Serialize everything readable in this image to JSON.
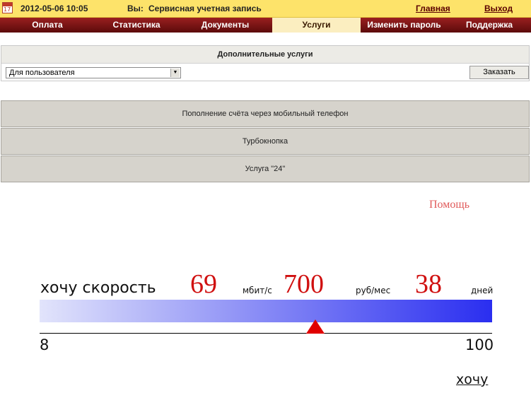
{
  "topbar": {
    "calendar_icon": "calendar-icon",
    "calendar_day": "17",
    "datetime": "2012-05-06 10:05",
    "you_label": "Вы:",
    "account": "Сервисная учетная запись",
    "home_link": "Главная",
    "logout_link": "Выход"
  },
  "nav": {
    "items": [
      "Оплата",
      "Статистика",
      "Документы",
      "Услуги",
      "Изменить пароль",
      "Поддержка"
    ],
    "active": "Услуги"
  },
  "extra_services": {
    "title": "Дополнительные услуги",
    "select_value": "Для пользователя",
    "order_button": "Заказать"
  },
  "services": [
    "Пополнение счёта через мобильный телефон",
    "Турбокнопка",
    "Услуга \"24\""
  ],
  "help_link": "Помощь",
  "speed_widget": {
    "label": "хочу скорость",
    "speed": "69",
    "speed_unit": "мбит/с",
    "price": "700",
    "price_unit": "руб/мес",
    "days": "38",
    "days_unit": "дней",
    "min": "8",
    "max": "100",
    "slider_value": 69,
    "gradient_colors": [
      "#e2e4fb",
      "#2a2ef0"
    ],
    "slider_color": "#e00000",
    "want_link": "хочу"
  }
}
